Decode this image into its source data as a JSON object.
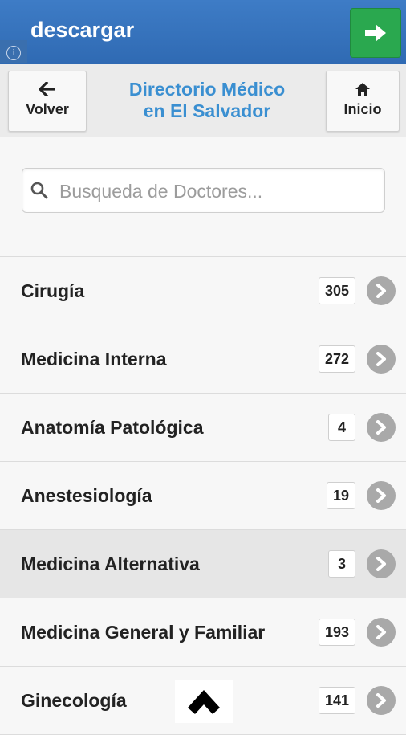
{
  "ad": {
    "title": "descargar",
    "info_glyph": "i",
    "go_icon": "arrow-right-icon",
    "go_color": "#2aa84f",
    "banner_color": "#3477c3"
  },
  "header": {
    "back_label": "Volver",
    "back_icon": "arrow-left-icon",
    "title_line1": "Directorio Médico",
    "title_line2": "en El Salvador",
    "title_color": "#3a8fd1",
    "home_label": "Inicio",
    "home_icon": "home-icon"
  },
  "search": {
    "placeholder": "Busqueda de Doctores...",
    "value": "",
    "icon": "search-icon"
  },
  "specialties": [
    {
      "label": "Cirugía",
      "count": "305"
    },
    {
      "label": "Medicina Interna",
      "count": "272"
    },
    {
      "label": "Anatomía Patológica",
      "count": "4"
    },
    {
      "label": "Anestesiología",
      "count": "19"
    },
    {
      "label": "Medicina Alternativa",
      "count": "3",
      "active": true
    },
    {
      "label": "Medicina General y Familiar",
      "count": "193"
    },
    {
      "label": "Ginecología",
      "count": "141"
    }
  ],
  "scroll_top_icon": "chevron-up-icon"
}
